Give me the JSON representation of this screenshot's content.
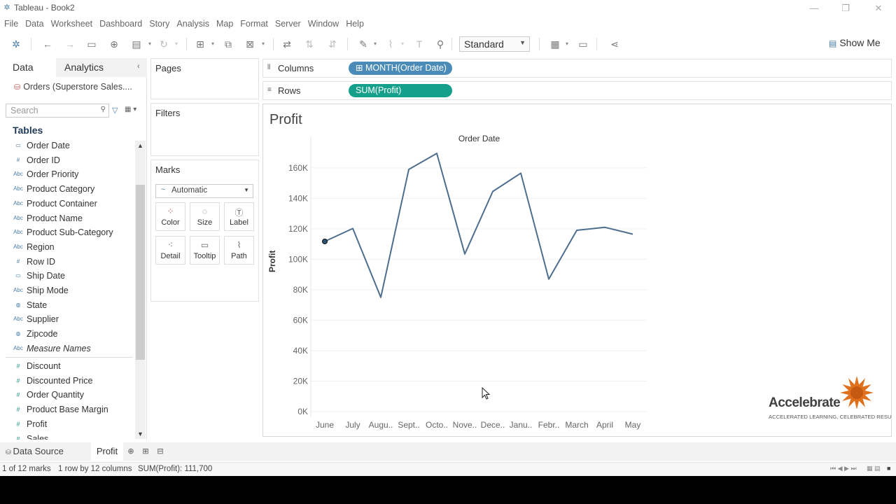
{
  "window": {
    "title": "Tableau - Book2",
    "minimize": "—",
    "restore": "❐",
    "close": "✕"
  },
  "menu": [
    "File",
    "Data",
    "Worksheet",
    "Dashboard",
    "Story",
    "Analysis",
    "Map",
    "Format",
    "Server",
    "Window",
    "Help"
  ],
  "toolbar": {
    "fit_select": "Standard",
    "show_me": "Show Me"
  },
  "data_pane": {
    "tab_data": "Data",
    "tab_analytics": "Analytics",
    "collapse": "‹",
    "datasource": "Orders (Superstore Sales....",
    "search_placeholder": "Search",
    "tables_heading": "Tables",
    "dimensions": [
      {
        "label": "Order Date",
        "icon": "date-icon"
      },
      {
        "label": "Order ID",
        "icon": "number-icon"
      },
      {
        "label": "Order Priority",
        "icon": "abc-icon"
      },
      {
        "label": "Product Category",
        "icon": "abc-icon"
      },
      {
        "label": "Product Container",
        "icon": "abc-icon"
      },
      {
        "label": "Product Name",
        "icon": "abc-icon"
      },
      {
        "label": "Product Sub-Category",
        "icon": "abc-icon"
      },
      {
        "label": "Region",
        "icon": "abc-icon"
      },
      {
        "label": "Row ID",
        "icon": "number-icon"
      },
      {
        "label": "Ship Date",
        "icon": "date-icon"
      },
      {
        "label": "Ship Mode",
        "icon": "abc-icon"
      },
      {
        "label": "State",
        "icon": "globe-icon"
      },
      {
        "label": "Supplier",
        "icon": "abc-icon"
      },
      {
        "label": "Zipcode",
        "icon": "globe-icon"
      },
      {
        "label": "Measure Names",
        "icon": "abc-icon"
      }
    ],
    "measures": [
      "Discount",
      "Discounted Price",
      "Order Quantity",
      "Product Base Margin",
      "Profit",
      "Sales"
    ]
  },
  "cards": {
    "pages": "Pages",
    "filters": "Filters",
    "marks": "Marks",
    "mark_type": "Automatic",
    "mark_buttons": [
      {
        "label": "Color",
        "icon": "color-icon"
      },
      {
        "label": "Size",
        "icon": "size-icon"
      },
      {
        "label": "Label",
        "icon": "label-icon"
      },
      {
        "label": "Detail",
        "icon": "detail-icon"
      },
      {
        "label": "Tooltip",
        "icon": "tooltip-icon"
      },
      {
        "label": "Path",
        "icon": "path-icon"
      }
    ]
  },
  "shelves": {
    "columns_label": "Columns",
    "columns_pill": "MONTH(Order Date)",
    "rows_label": "Rows",
    "rows_pill": "SUM(Profit)"
  },
  "view": {
    "title": "Profit",
    "logo_name": "Accelebrate",
    "logo_tagline": "ACCELERATED LEARNING, CELEBRATED RESULTS®"
  },
  "chart_data": {
    "type": "line",
    "title": "",
    "xlabel": "Order Date",
    "ylabel": "Profit",
    "categories": [
      "June",
      "July",
      "Augu..",
      "Sept..",
      "Octo..",
      "Nove..",
      "Dece..",
      "Janu..",
      "Febr..",
      "March",
      "April",
      "May"
    ],
    "values": [
      111700,
      120200,
      75000,
      159000,
      169500,
      103500,
      144500,
      156500,
      87000,
      119000,
      121000,
      116500
    ],
    "y_ticks": [
      "0K",
      "20K",
      "40K",
      "60K",
      "80K",
      "100K",
      "120K",
      "140K",
      "160K"
    ],
    "ylim": [
      0,
      176000
    ],
    "grid": true,
    "line_color": "#4e6e8e",
    "selected_index": 0
  },
  "sheets": {
    "data_source": "Data Source",
    "active": "Profit"
  },
  "status": {
    "marks": "1 of 12 marks",
    "dims": "1 row by 12 columns",
    "sum": "SUM(Profit): 111,700"
  }
}
